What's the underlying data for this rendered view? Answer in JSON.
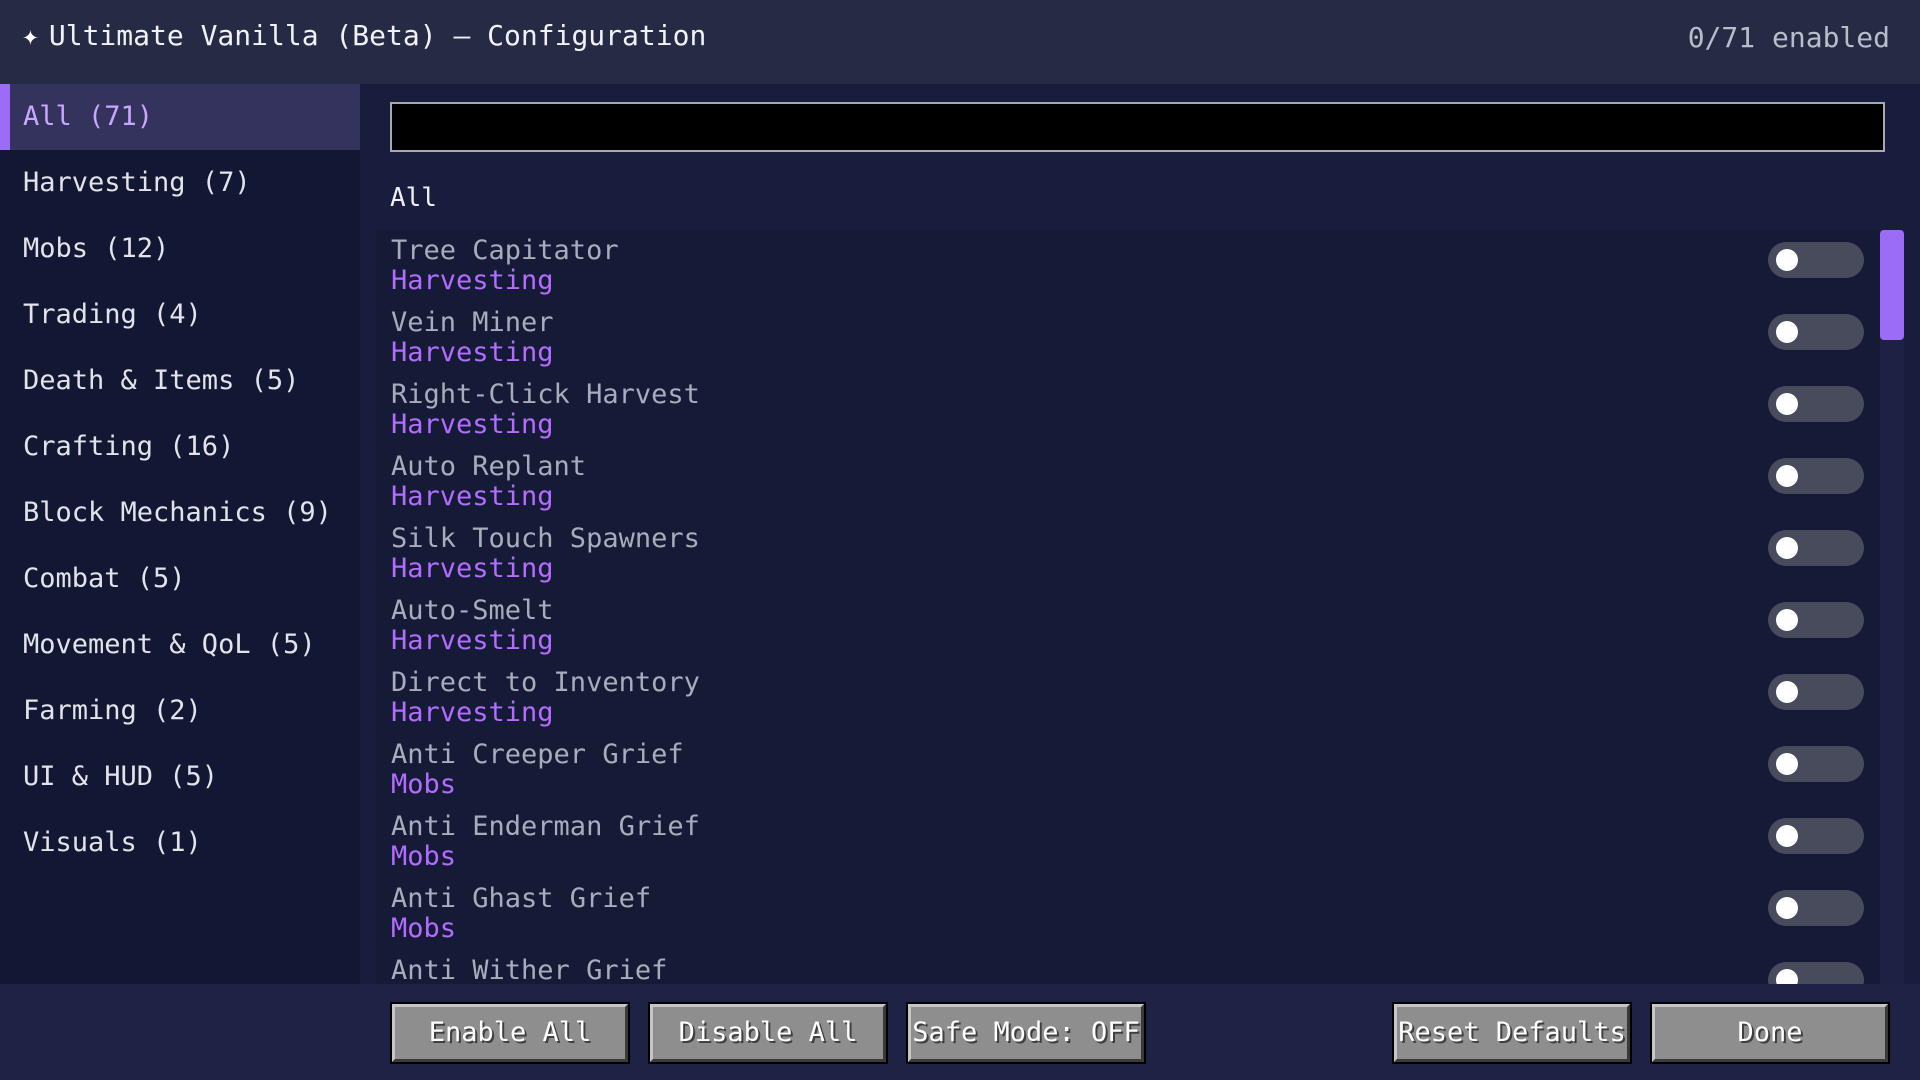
{
  "header": {
    "title": "Ultimate Vanilla (Beta) — Configuration",
    "star_icon": "✦",
    "enabled_count": "0/71 enabled"
  },
  "sidebar": {
    "items": [
      {
        "label": "All (71)",
        "active": true
      },
      {
        "label": "Harvesting (7)"
      },
      {
        "label": "Mobs (12)"
      },
      {
        "label": "Trading (4)"
      },
      {
        "label": "Death & Items (5)"
      },
      {
        "label": "Crafting (16)"
      },
      {
        "label": "Block Mechanics (9)"
      },
      {
        "label": "Combat (5)"
      },
      {
        "label": "Movement & QoL (5)"
      },
      {
        "label": "Farming (2)"
      },
      {
        "label": "UI & HUD (5)"
      },
      {
        "label": "Visuals (1)"
      }
    ]
  },
  "main": {
    "search": {
      "value": "",
      "placeholder": ""
    },
    "section_label": "All",
    "features": [
      {
        "name": "Tree Capitator",
        "category": "Harvesting",
        "enabled": false
      },
      {
        "name": "Vein Miner",
        "category": "Harvesting",
        "enabled": false
      },
      {
        "name": "Right-Click Harvest",
        "category": "Harvesting",
        "enabled": false
      },
      {
        "name": "Auto Replant",
        "category": "Harvesting",
        "enabled": false
      },
      {
        "name": "Silk Touch Spawners",
        "category": "Harvesting",
        "enabled": false
      },
      {
        "name": "Auto-Smelt",
        "category": "Harvesting",
        "enabled": false
      },
      {
        "name": "Direct to Inventory",
        "category": "Harvesting",
        "enabled": false
      },
      {
        "name": "Anti Creeper Grief",
        "category": "Mobs",
        "enabled": false
      },
      {
        "name": "Anti Enderman Grief",
        "category": "Mobs",
        "enabled": false
      },
      {
        "name": "Anti Ghast Grief",
        "category": "Mobs",
        "enabled": false
      },
      {
        "name": "Anti Wither Grief",
        "category": "",
        "enabled": false
      }
    ]
  },
  "footer": {
    "enable_all": "Enable All",
    "disable_all": "Disable All",
    "safe_mode": "Safe Mode: OFF",
    "reset_defaults": "Reset Defaults",
    "done": "Done"
  },
  "colors": {
    "accent": "#9b6cf5",
    "category_text": "#b36cff",
    "toggle_off": "#474b5c"
  }
}
